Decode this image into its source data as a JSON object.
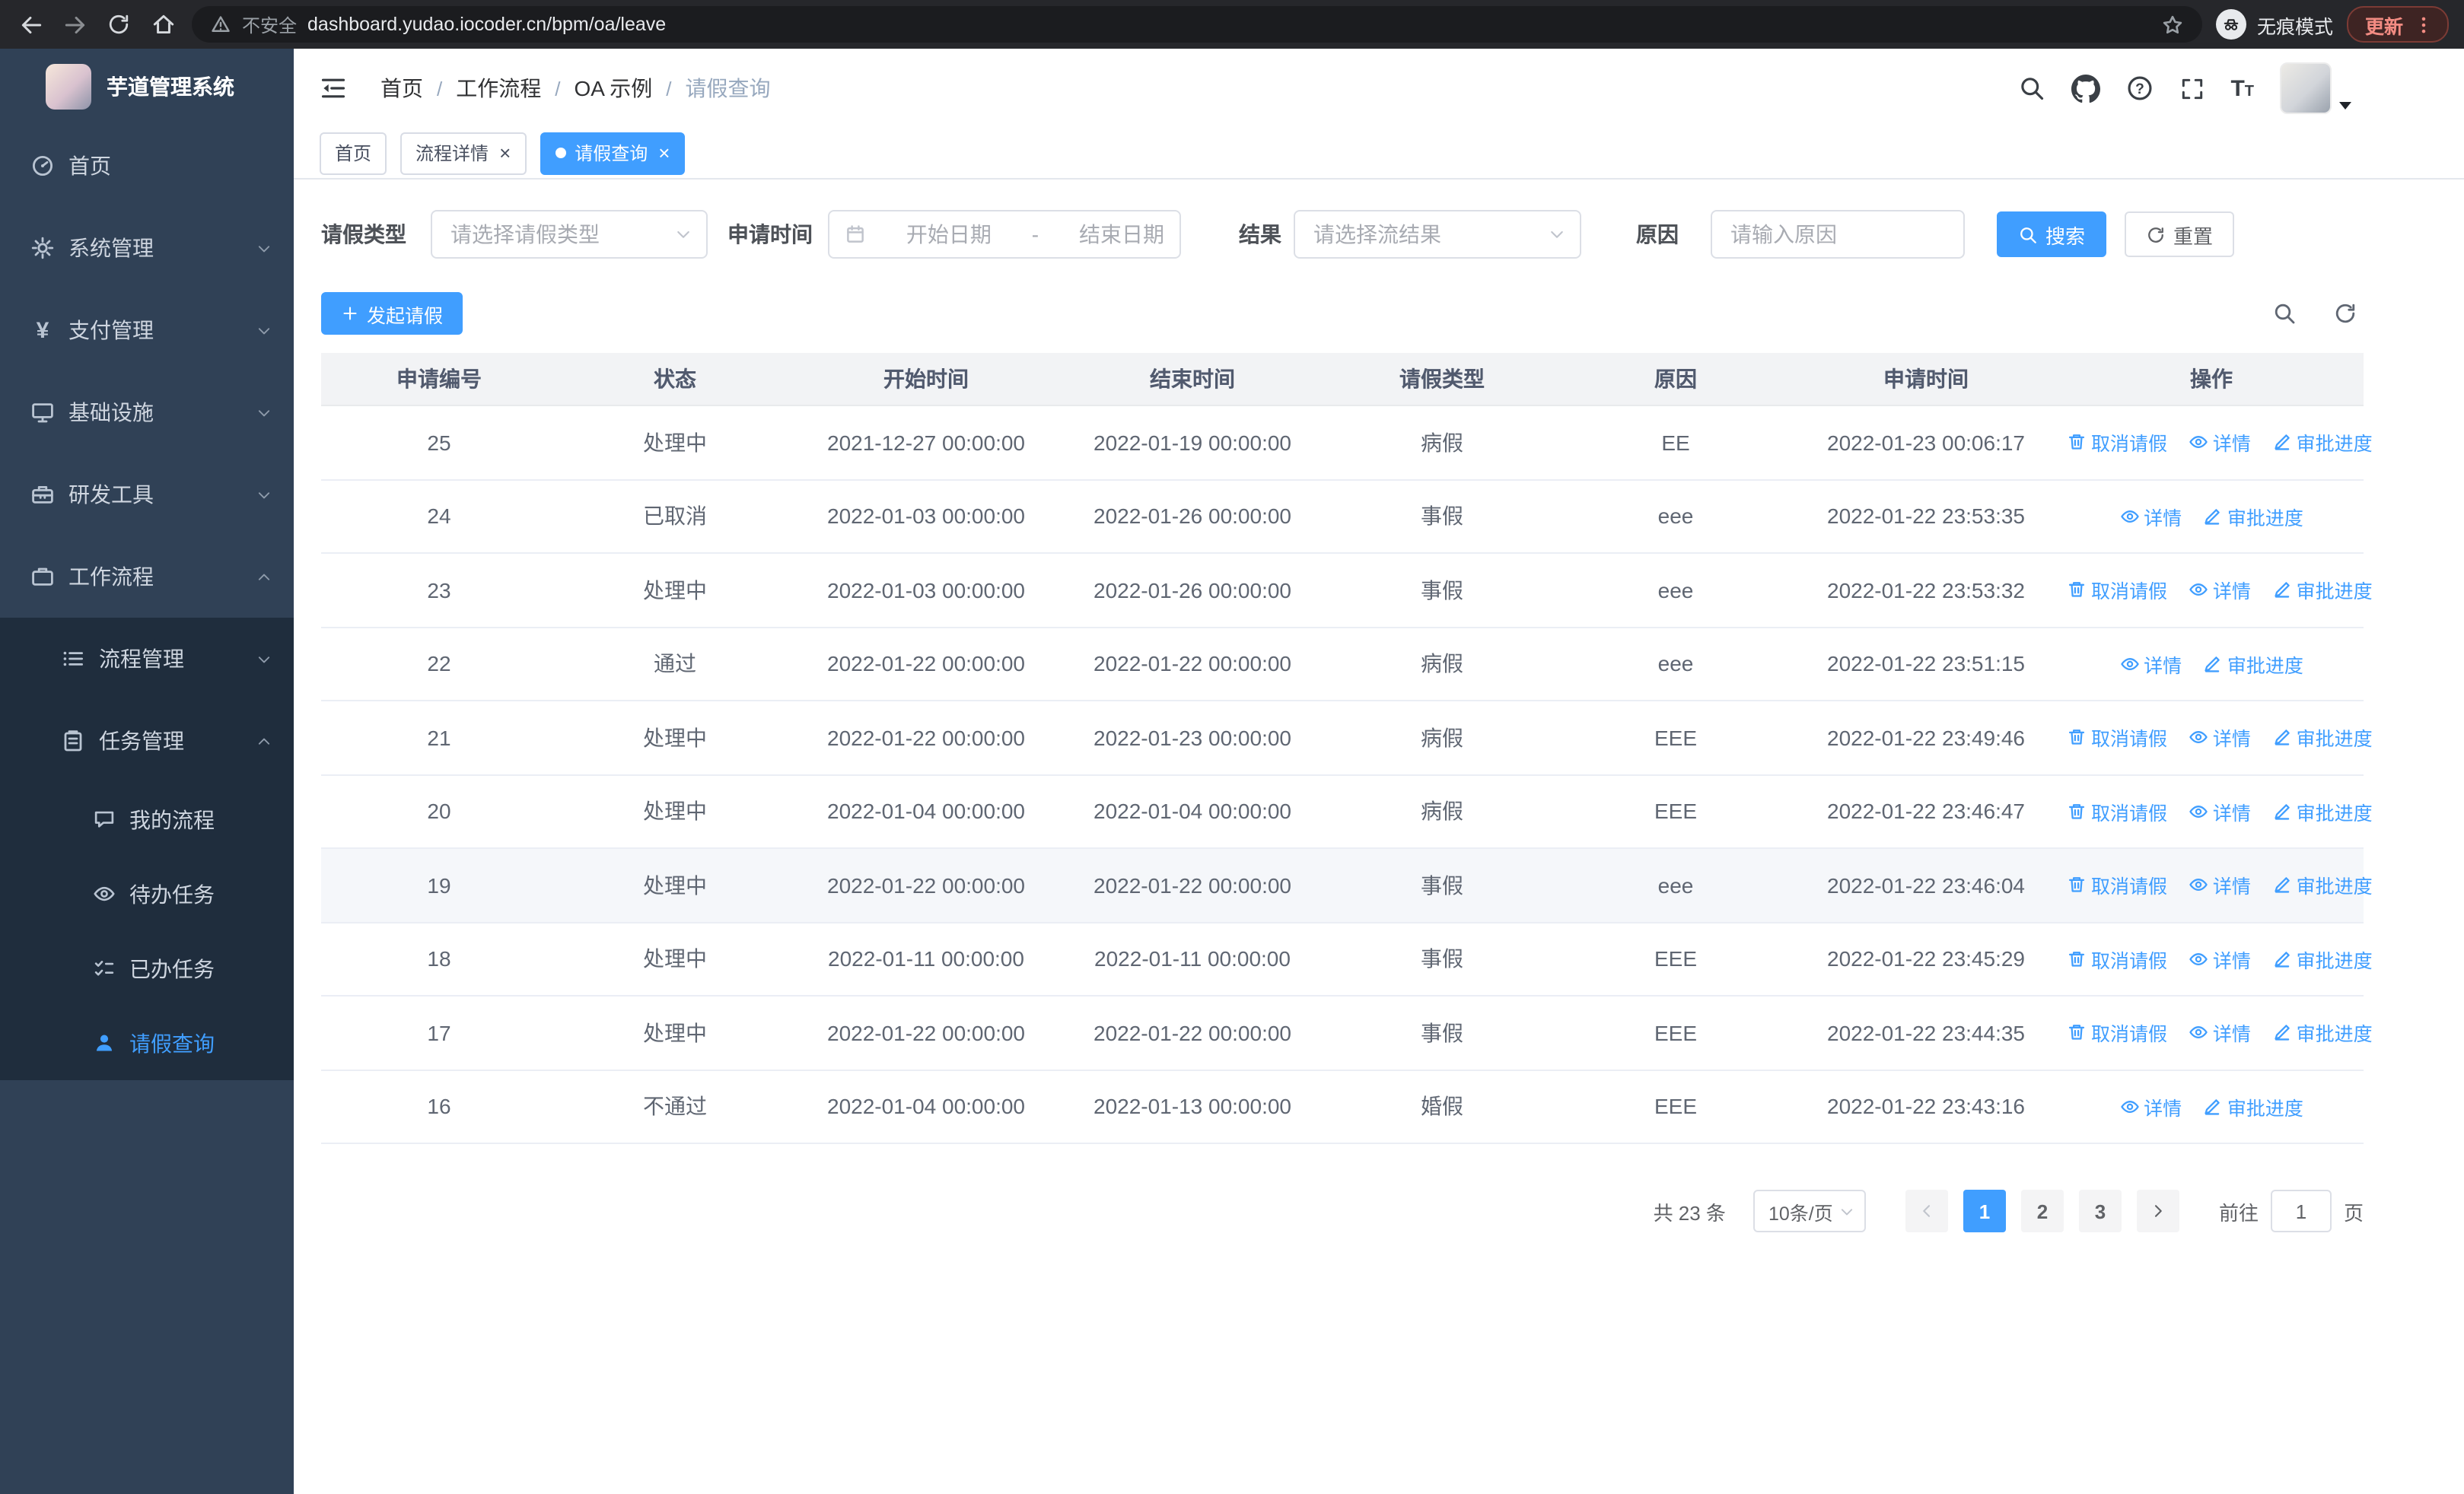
{
  "browser": {
    "security_label": "不安全",
    "url": "dashboard.yudao.iocoder.cn/bpm/oa/leave",
    "incognito_label": "无痕模式",
    "update_label": "更新"
  },
  "ui": {
    "close_glyph": "×",
    "breadcrumb_separator": "/"
  },
  "sidebar": {
    "app_title": "芋道管理系统",
    "items": [
      {
        "label": "首页"
      },
      {
        "label": "系统管理"
      },
      {
        "label": "支付管理"
      },
      {
        "label": "基础设施"
      },
      {
        "label": "研发工具"
      },
      {
        "label": "工作流程"
      },
      {
        "label": "流程管理"
      },
      {
        "label": "任务管理"
      },
      {
        "label": "我的流程"
      },
      {
        "label": "待办任务"
      },
      {
        "label": "已办任务"
      },
      {
        "label": "请假查询"
      }
    ]
  },
  "breadcrumb": {
    "items": [
      "首页",
      "工作流程",
      "OA 示例",
      "请假查询"
    ]
  },
  "tabs": [
    {
      "label": "首页",
      "closable": false,
      "active": false
    },
    {
      "label": "流程详情",
      "closable": true,
      "active": false
    },
    {
      "label": "请假查询",
      "closable": true,
      "active": true
    }
  ],
  "filters": {
    "leave_type_label": "请假类型",
    "leave_type_placeholder": "请选择请假类型",
    "apply_time_label": "申请时间",
    "start_date_placeholder": "开始日期",
    "date_separator": "-",
    "end_date_placeholder": "结束日期",
    "result_label": "结果",
    "result_placeholder": "请选择流结果",
    "reason_label": "原因",
    "reason_placeholder": "请输入原因",
    "search_button": "搜索",
    "reset_button": "重置"
  },
  "toolbar": {
    "create_button": "发起请假"
  },
  "table": {
    "columns": [
      "申请编号",
      "状态",
      "开始时间",
      "结束时间",
      "请假类型",
      "原因",
      "申请时间",
      "操作"
    ],
    "action_labels": {
      "cancel": "取消请假",
      "detail": "详情",
      "progress": "审批进度"
    },
    "rows": [
      {
        "id": "25",
        "status": "处理中",
        "start": "2021-12-27 00:00:00",
        "end": "2022-01-19 00:00:00",
        "type": "病假",
        "reason": "EE",
        "apply_time": "2022-01-23 00:06:17",
        "cancelable": true,
        "hover": false
      },
      {
        "id": "24",
        "status": "已取消",
        "start": "2022-01-03 00:00:00",
        "end": "2022-01-26 00:00:00",
        "type": "事假",
        "reason": "eee",
        "apply_time": "2022-01-22 23:53:35",
        "cancelable": false,
        "hover": false
      },
      {
        "id": "23",
        "status": "处理中",
        "start": "2022-01-03 00:00:00",
        "end": "2022-01-26 00:00:00",
        "type": "事假",
        "reason": "eee",
        "apply_time": "2022-01-22 23:53:32",
        "cancelable": true,
        "hover": false
      },
      {
        "id": "22",
        "status": "通过",
        "start": "2022-01-22 00:00:00",
        "end": "2022-01-22 00:00:00",
        "type": "病假",
        "reason": "eee",
        "apply_time": "2022-01-22 23:51:15",
        "cancelable": false,
        "hover": false
      },
      {
        "id": "21",
        "status": "处理中",
        "start": "2022-01-22 00:00:00",
        "end": "2022-01-23 00:00:00",
        "type": "病假",
        "reason": "EEE",
        "apply_time": "2022-01-22 23:49:46",
        "cancelable": true,
        "hover": false
      },
      {
        "id": "20",
        "status": "处理中",
        "start": "2022-01-04 00:00:00",
        "end": "2022-01-04 00:00:00",
        "type": "病假",
        "reason": "EEE",
        "apply_time": "2022-01-22 23:46:47",
        "cancelable": true,
        "hover": false
      },
      {
        "id": "19",
        "status": "处理中",
        "start": "2022-01-22 00:00:00",
        "end": "2022-01-22 00:00:00",
        "type": "事假",
        "reason": "eee",
        "apply_time": "2022-01-22 23:46:04",
        "cancelable": true,
        "hover": true
      },
      {
        "id": "18",
        "status": "处理中",
        "start": "2022-01-11 00:00:00",
        "end": "2022-01-11 00:00:00",
        "type": "事假",
        "reason": "EEE",
        "apply_time": "2022-01-22 23:45:29",
        "cancelable": true,
        "hover": false
      },
      {
        "id": "17",
        "status": "处理中",
        "start": "2022-01-22 00:00:00",
        "end": "2022-01-22 00:00:00",
        "type": "事假",
        "reason": "EEE",
        "apply_time": "2022-01-22 23:44:35",
        "cancelable": true,
        "hover": false
      },
      {
        "id": "16",
        "status": "不通过",
        "start": "2022-01-04 00:00:00",
        "end": "2022-01-13 00:00:00",
        "type": "婚假",
        "reason": "EEE",
        "apply_time": "2022-01-22 23:43:16",
        "cancelable": false,
        "hover": false
      }
    ]
  },
  "pagination": {
    "total_label": "共 23 条",
    "page_size": "10条/页",
    "pages": [
      "1",
      "2",
      "3"
    ],
    "active_page": "1",
    "goto_label": "前往",
    "goto_value": "1",
    "page_suffix": "页"
  },
  "colors": {
    "primary": "#409EFF",
    "sidebar_bg": "#304156",
    "sidebar_submenu_bg": "#1f2d3d",
    "update_badge_text": "#f28b82",
    "table_header_bg": "#f2f3f5"
  }
}
